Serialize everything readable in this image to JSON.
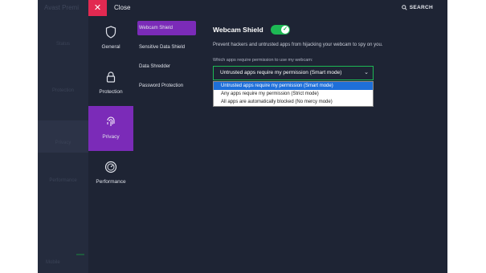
{
  "background_app": {
    "logo": "Avast Premi",
    "items": [
      "Status",
      "Protection",
      "Privacy",
      "Performance"
    ],
    "footer": "Mobile"
  },
  "topbar": {
    "close_label": "Close",
    "search_label": "SEARCH"
  },
  "categories": [
    {
      "label": "General",
      "icon": "shield-icon"
    },
    {
      "label": "Protection",
      "icon": "lock-icon"
    },
    {
      "label": "Privacy",
      "icon": "fingerprint-icon",
      "active": true
    },
    {
      "label": "Performance",
      "icon": "gauge-icon"
    }
  ],
  "subnav": [
    {
      "label": "Webcam Shield",
      "active": true
    },
    {
      "label": "Sensitive Data Shield"
    },
    {
      "label": "Data Shredder"
    },
    {
      "label": "Password Protection"
    }
  ],
  "content": {
    "title": "Webcam Shield",
    "toggle_on": true,
    "description": "Prevent hackers and untrusted apps from hijacking your webcam to spy on you.",
    "question": "Which apps require permission to use my webcam:",
    "selected_value": "Untrusted apps require my permission (Smart mode)",
    "options": [
      "Untrusted apps require my permission (Smart mode)",
      "Any apps require my permission (Strict mode)",
      "All apps are automatically blocked (No mercy mode)"
    ]
  },
  "colors": {
    "accent_purple": "#7b2bb8",
    "close_red": "#e22951",
    "toggle_green": "#1db954",
    "highlight_blue": "#1e6fd9",
    "panel_bg": "#1e2434"
  }
}
